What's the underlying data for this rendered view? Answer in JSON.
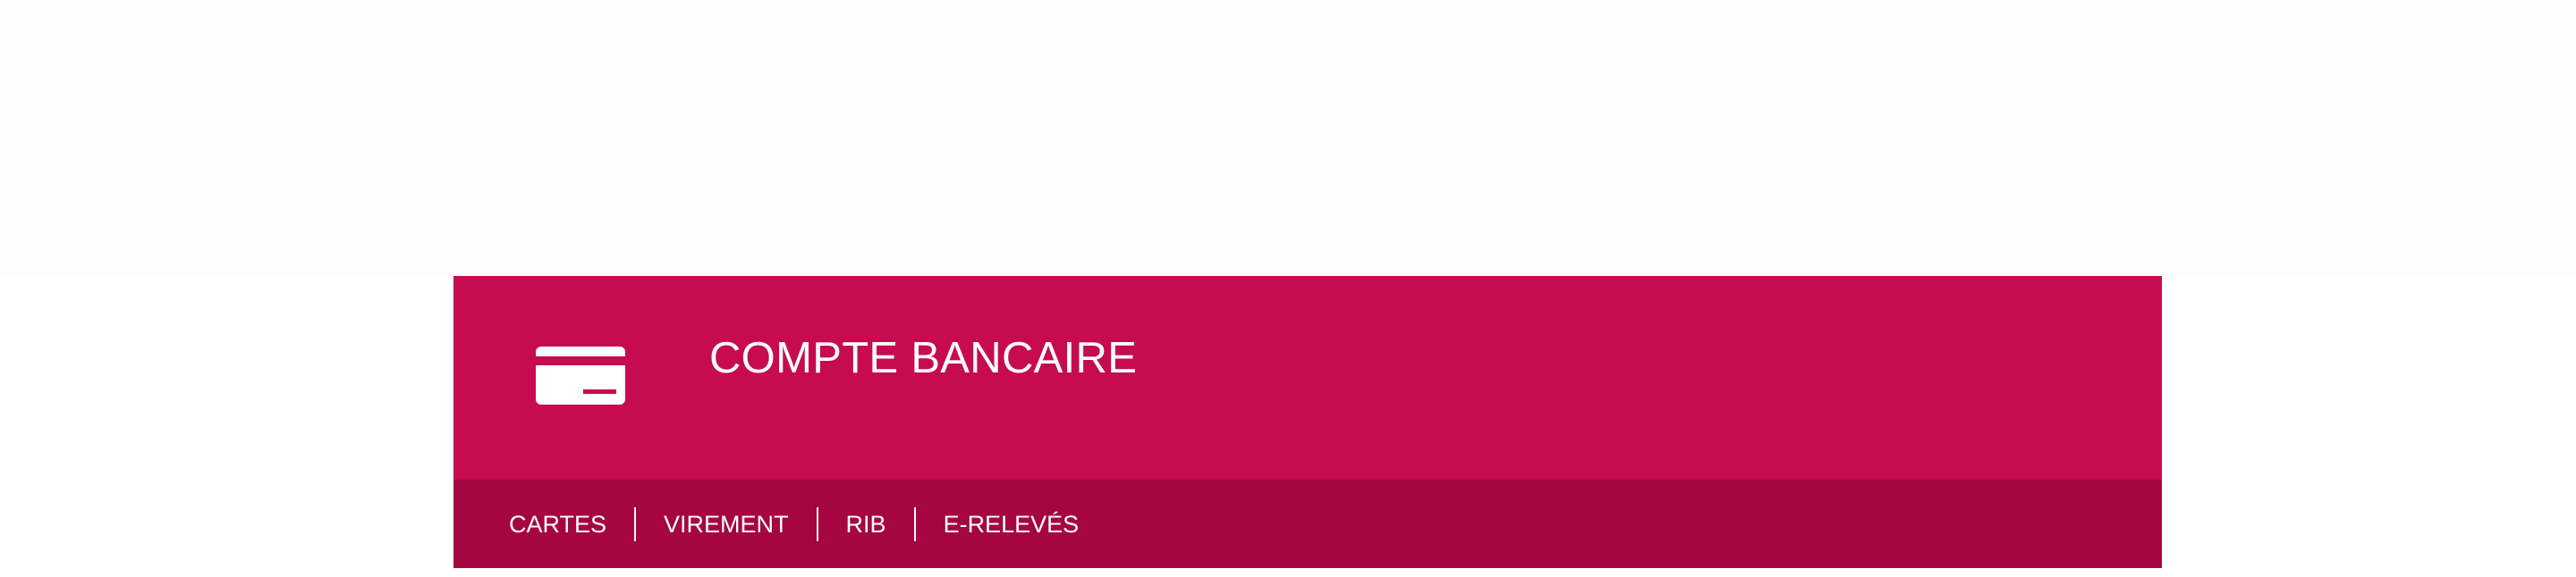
{
  "colors": {
    "header_bg": "#c70b50",
    "nav_bg": "#a50540",
    "text": "#ffffff"
  },
  "panel": {
    "icon": "credit-card-icon",
    "title": "COMPTE BANCAIRE"
  },
  "nav": {
    "items": [
      {
        "label": "CARTES"
      },
      {
        "label": "VIREMENT"
      },
      {
        "label": "RIB"
      },
      {
        "label": "E-RELEVÉS"
      }
    ]
  }
}
